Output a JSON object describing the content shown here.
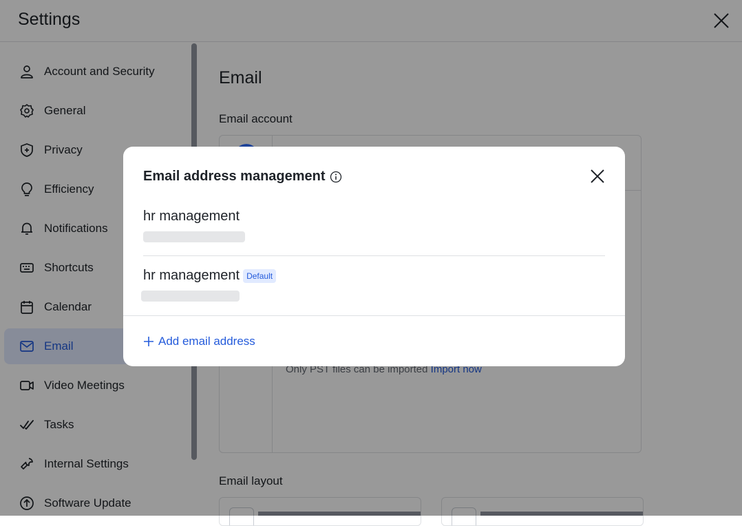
{
  "header": {
    "title": "Settings"
  },
  "sidebar": {
    "items": [
      {
        "label": "Account and Security",
        "icon": "person-icon"
      },
      {
        "label": "General",
        "icon": "gear-icon"
      },
      {
        "label": "Privacy",
        "icon": "shield-icon"
      },
      {
        "label": "Efficiency",
        "icon": "bulb-icon"
      },
      {
        "label": "Notifications",
        "icon": "bell-icon"
      },
      {
        "label": "Shortcuts",
        "icon": "keyboard-icon"
      },
      {
        "label": "Calendar",
        "icon": "calendar-icon"
      },
      {
        "label": "Email",
        "icon": "mail-icon",
        "active": true
      },
      {
        "label": "Video Meetings",
        "icon": "video-icon"
      },
      {
        "label": "Tasks",
        "icon": "tasks-icon"
      },
      {
        "label": "Internal Settings",
        "icon": "wrench-icon"
      },
      {
        "label": "Software Update",
        "icon": "update-icon"
      }
    ]
  },
  "main": {
    "title": "Email",
    "email_account_label": "Email account",
    "import_note": "Only PST files can be imported",
    "import_link": "Import now",
    "email_layout_label": "Email layout"
  },
  "modal": {
    "title": "Email address management",
    "entries": [
      {
        "name": "hr management"
      },
      {
        "name": "hr management",
        "badge": "Default"
      }
    ],
    "add_label": "Add email address"
  },
  "colors": {
    "accent": "#245bdb",
    "active_bg": "#e1eaff"
  }
}
